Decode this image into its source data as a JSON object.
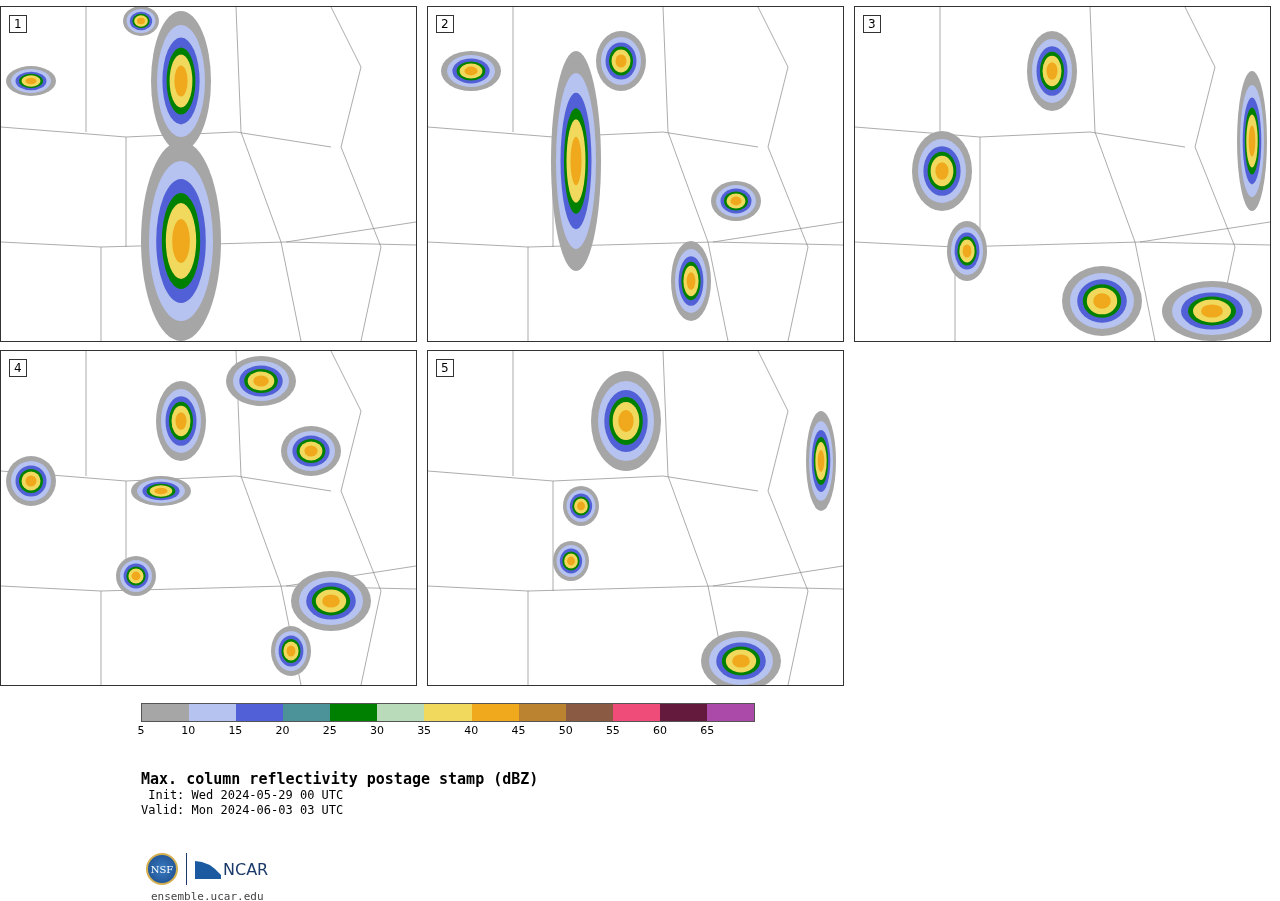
{
  "panels": [
    {
      "label": "1"
    },
    {
      "label": "2"
    },
    {
      "label": "3"
    },
    {
      "label": "4"
    },
    {
      "label": "5"
    }
  ],
  "colorbar": {
    "segments": [
      {
        "color": "#a6a6a6"
      },
      {
        "color": "#b6c2ef"
      },
      {
        "color": "#5160d6"
      },
      {
        "color": "#4c9399"
      },
      {
        "color": "#008000"
      },
      {
        "color": "#b9dbba"
      },
      {
        "color": "#f0d95c"
      },
      {
        "color": "#f0a91c"
      },
      {
        "color": "#bb8330"
      },
      {
        "color": "#8a5a42"
      },
      {
        "color": "#f04c7a"
      },
      {
        "color": "#631a3c"
      },
      {
        "color": "#ab4aa8"
      }
    ],
    "ticks": [
      "5",
      "10",
      "15",
      "20",
      "25",
      "30",
      "35",
      "40",
      "45",
      "50",
      "55",
      "60",
      "65"
    ]
  },
  "title": "Max. column reflectivity postage stamp (dBZ)",
  "init": " Init: Wed 2024-05-29 00 UTC",
  "valid": "Valid: Mon 2024-06-03 03 UTC",
  "logo": {
    "nsf": "NSF",
    "ncar": "NCAR"
  },
  "url": "ensemble.ucar.edu"
}
